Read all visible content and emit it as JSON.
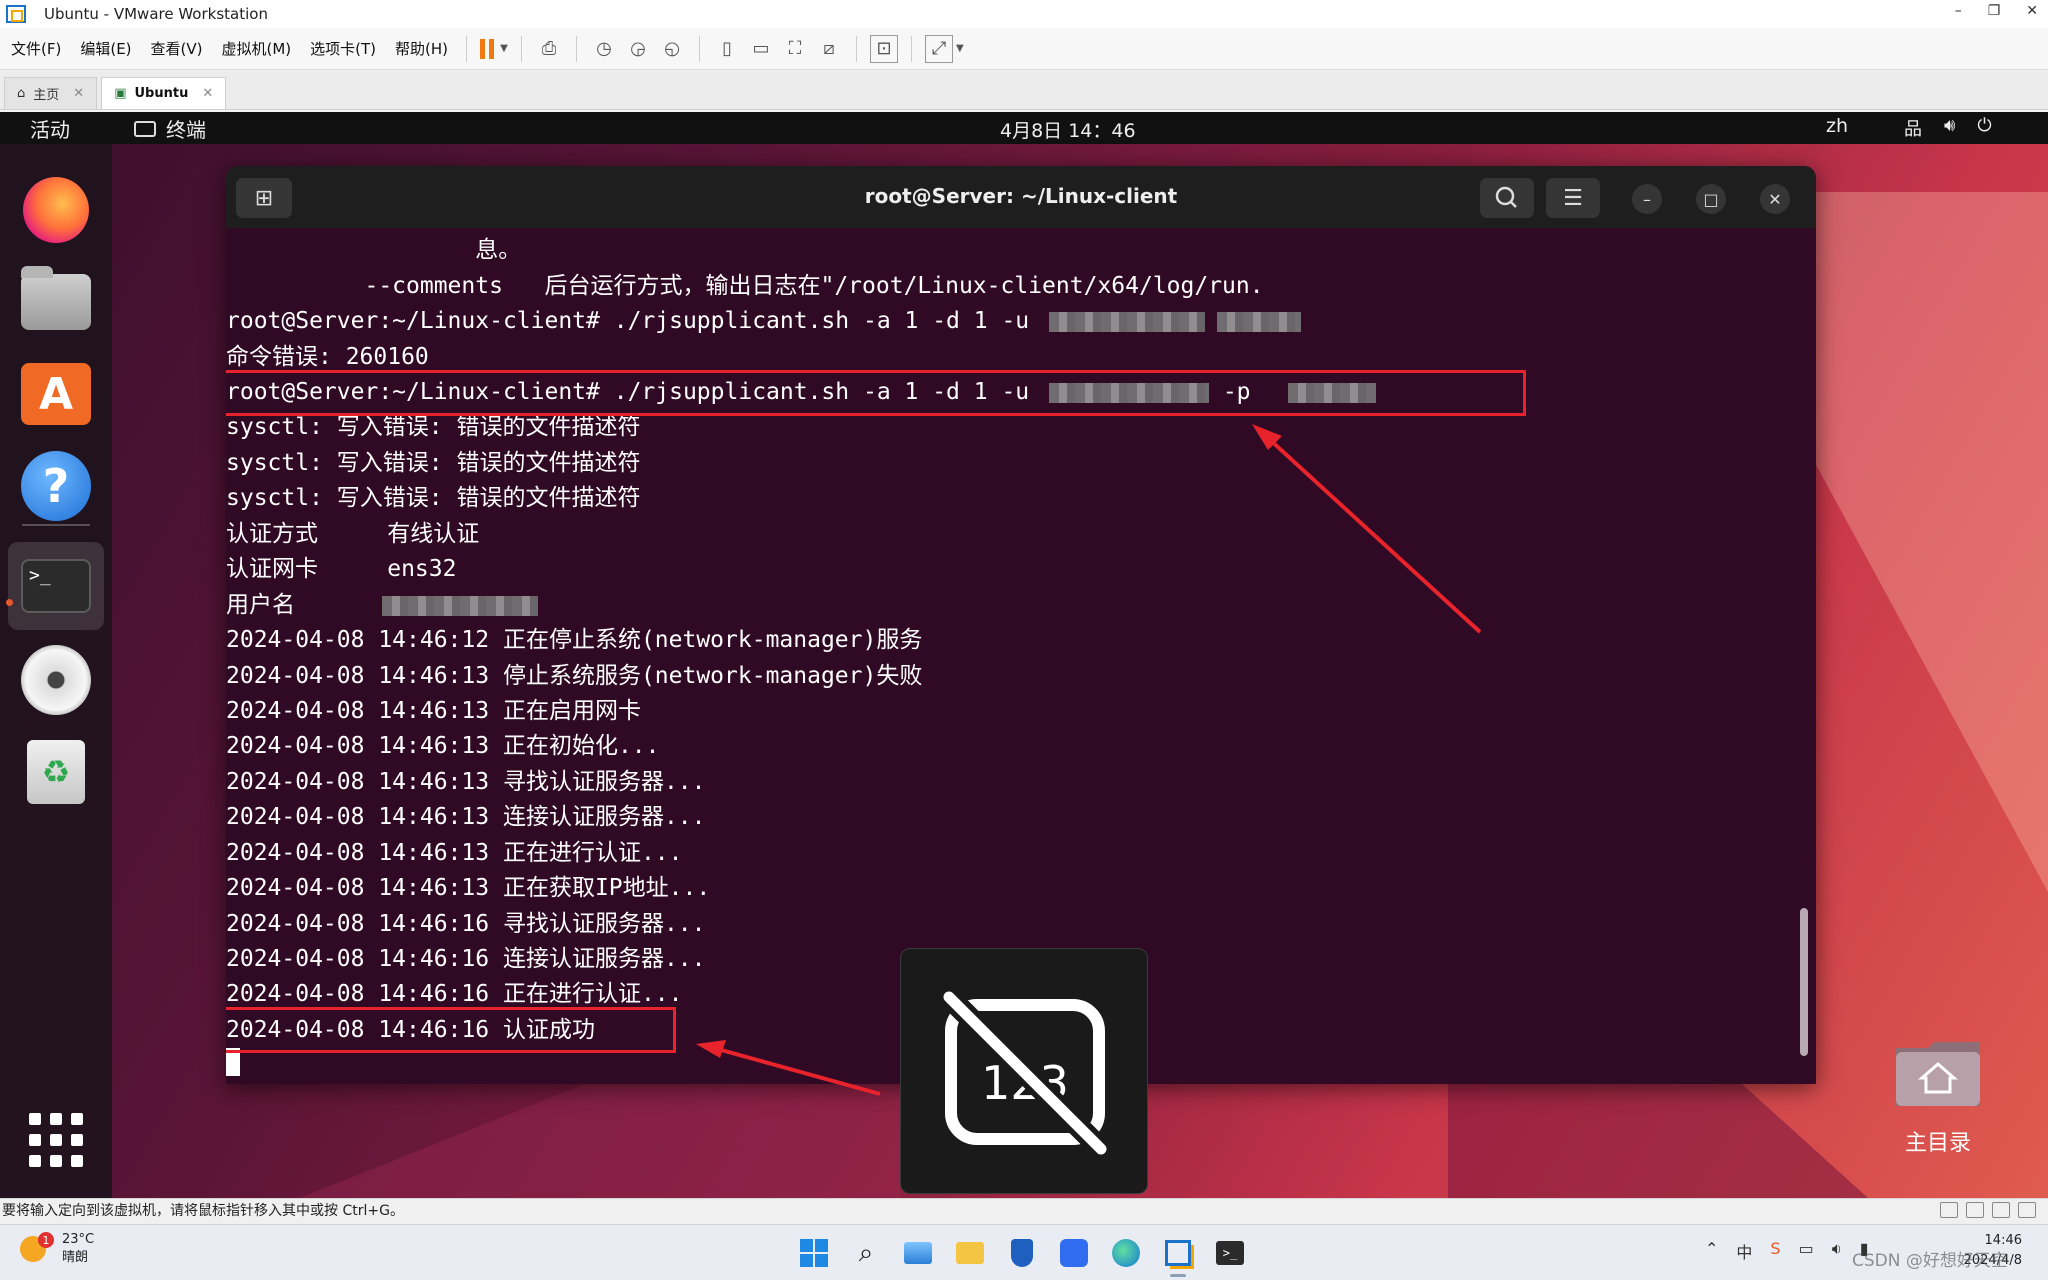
{
  "window": {
    "title": "Ubuntu - VMware Workstation",
    "controls": [
      "–",
      "❐",
      "✕"
    ]
  },
  "menubar": {
    "items": [
      "文件(F)",
      "编辑(E)",
      "查看(V)",
      "虚拟机(M)",
      "选项卡(T)",
      "帮助(H)"
    ]
  },
  "tabs": [
    {
      "label": "主页"
    },
    {
      "label": "Ubuntu"
    }
  ],
  "gnome": {
    "activities": "活动",
    "app_name": "终端",
    "clock": "4月8日  14：46",
    "lang": "zh"
  },
  "terminal": {
    "title": "root@Server: ~/Linux-client",
    "lines": [
      {
        "text": "                  息。"
      },
      {
        "text": "          --comments   后台运行方式，输出日志在\"/root/Linux-client/x64/log/run."
      },
      {
        "text": "root@Server:~/Linux-client# ./rjsupplicant.sh -a 1 -d 1 -u "
      },
      {
        "text": "命令错误: 260160"
      },
      {
        "text": "root@Server:~/Linux-client# ./rjsupplicant.sh -a 1 -d 1 -u ",
        "tail": " -p  "
      },
      {
        "text": "sysctl: 写入错误: 错误的文件描述符"
      },
      {
        "text": "sysctl: 写入错误: 错误的文件描述符"
      },
      {
        "text": "sysctl: 写入错误: 错误的文件描述符"
      },
      {
        "text": "认证方式     有线认证"
      },
      {
        "text": "认证网卡     ens32"
      },
      {
        "text": "用户名      "
      },
      {
        "text": "2024-04-08 14:46:12 正在停止系统(network-manager)服务"
      },
      {
        "text": "2024-04-08 14:46:13 停止系统服务(network-manager)失败"
      },
      {
        "text": "2024-04-08 14:46:13 正在启用网卡"
      },
      {
        "text": "2024-04-08 14:46:13 正在初始化..."
      },
      {
        "text": "2024-04-08 14:46:13 寻找认证服务器..."
      },
      {
        "text": "2024-04-08 14:46:13 连接认证服务器..."
      },
      {
        "text": "2024-04-08 14:46:13 正在进行认证..."
      },
      {
        "text": "2024-04-08 14:46:13 正在获取IP地址..."
      },
      {
        "text": "2024-04-08 14:46:16 寻找认证服务器..."
      },
      {
        "text": "2024-04-08 14:46:16 连接认证服务器..."
      },
      {
        "text": "2024-04-08 14:46:16 正在进行认证..."
      },
      {
        "text": "2024-04-08 14:46:16 认证成功"
      }
    ]
  },
  "osd": {
    "text": "123"
  },
  "desktop": {
    "home_label": "主目录"
  },
  "status_bar": {
    "text": "要将输入定向到该虚拟机，请将鼠标指针移入其中或按 Ctrl+G。"
  },
  "taskbar": {
    "weather": {
      "temp": "23°C",
      "desc": "晴朗",
      "badge": "1"
    },
    "ime": "中",
    "clock_time": "14:46",
    "clock_date": "2024/4/8"
  },
  "watermark": "CSDN @好想好天空",
  "colors": {
    "terminal_bg": "#300a24",
    "highlight": "#e8232b",
    "dock_bg": "#1e141c",
    "accent_orange": "#e8582a"
  }
}
